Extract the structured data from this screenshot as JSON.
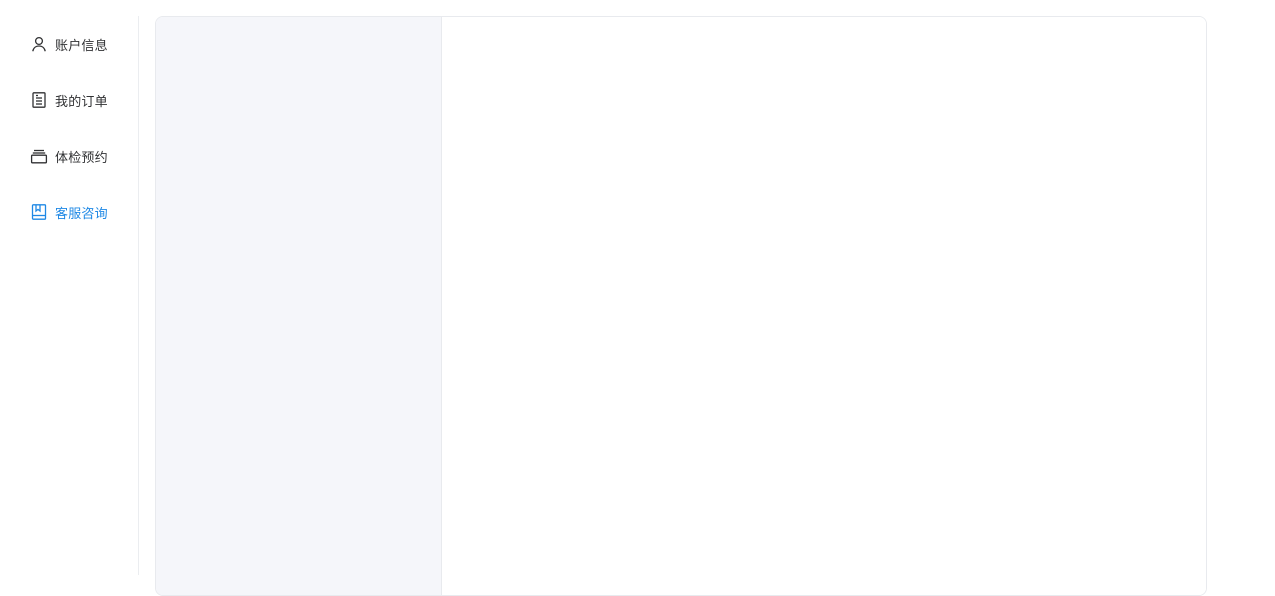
{
  "sidebar": {
    "items": [
      {
        "label": "账户信息",
        "icon": "user-icon",
        "active": false
      },
      {
        "label": "我的订单",
        "icon": "document-icon",
        "active": false
      },
      {
        "label": "体检预约",
        "icon": "card-stack-icon",
        "active": false
      },
      {
        "label": "客服咨询",
        "icon": "bookmark-book-icon",
        "active": true
      }
    ],
    "active_color": "#1e88e5",
    "text_color": "#303133"
  },
  "chat": {
    "conversation_list_bg": "#f5f6fa",
    "message_area_bg": "#ffffff"
  }
}
